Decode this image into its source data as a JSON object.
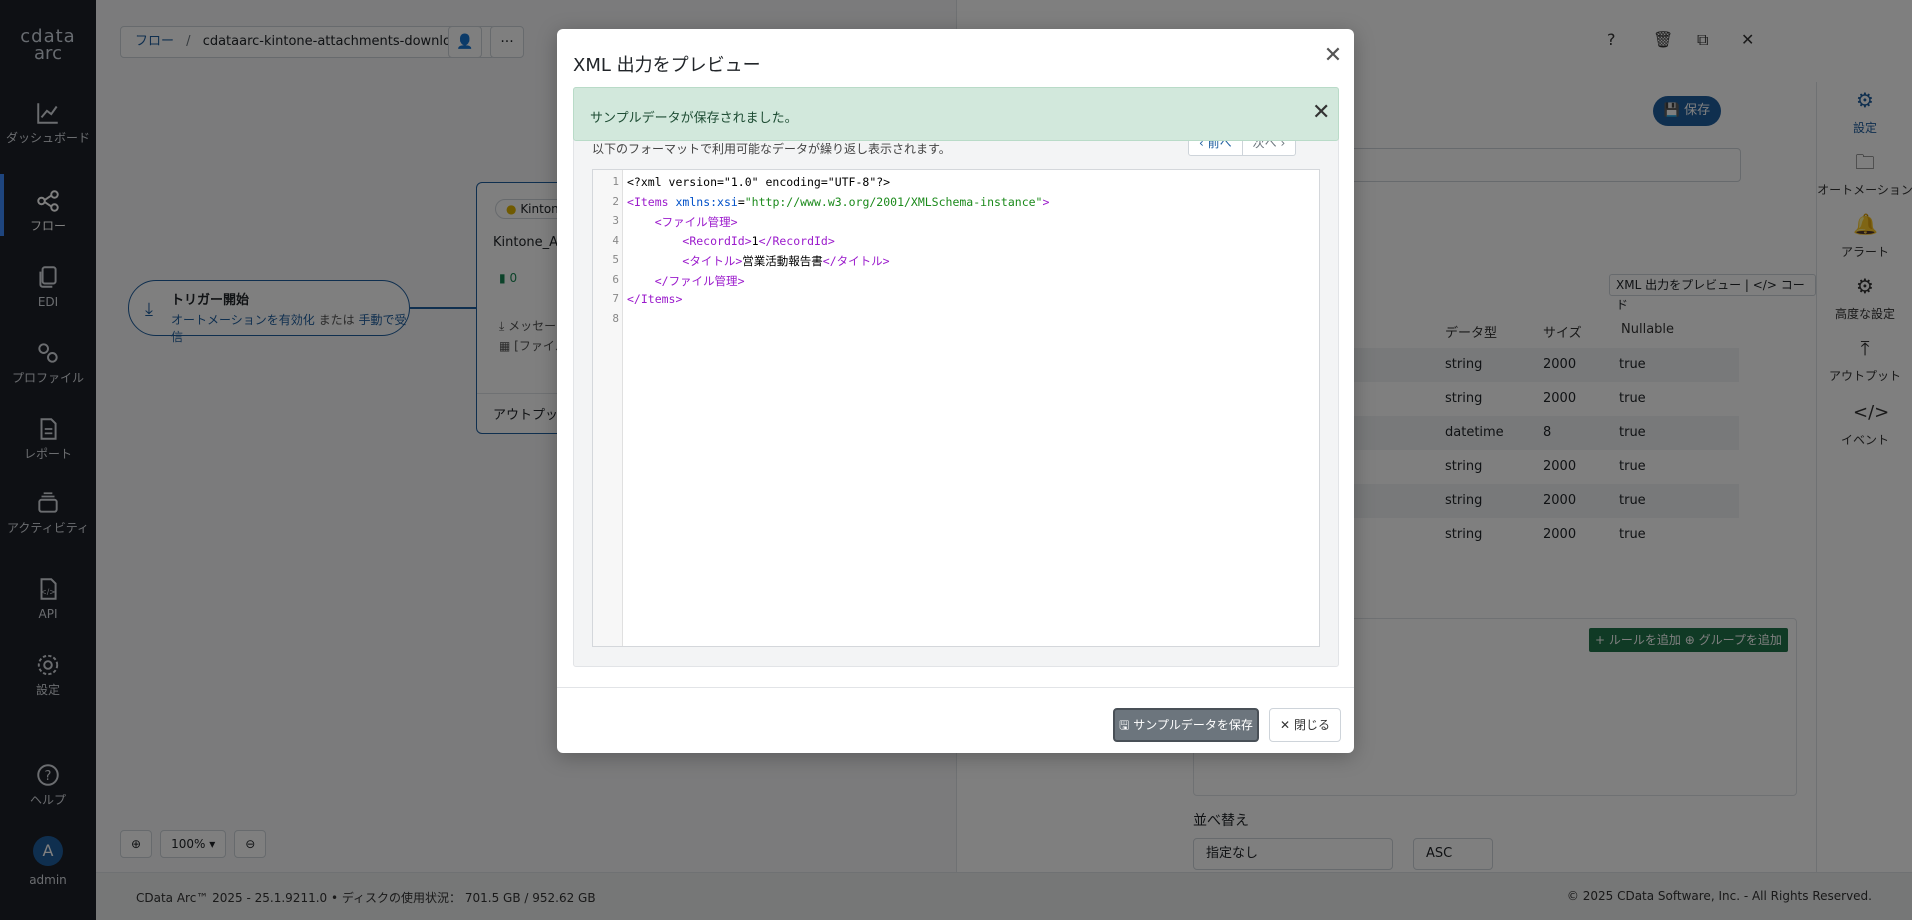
{
  "brand": {
    "name": "cdata",
    "sub": "arc"
  },
  "nav": {
    "items": [
      {
        "label": "ダッシュボード",
        "icon": "chart-line-icon"
      },
      {
        "label": "フロー",
        "icon": "flow-icon"
      },
      {
        "label": "EDI",
        "icon": "document-copy-icon"
      },
      {
        "label": "プロファイル",
        "icon": "gears-icon"
      },
      {
        "label": "レポート",
        "icon": "report-icon"
      },
      {
        "label": "アクティビティ",
        "icon": "layers-icon"
      },
      {
        "label": "API",
        "icon": "api-file-icon"
      },
      {
        "label": "設定",
        "icon": "gear-icon"
      }
    ],
    "help_label": "ヘルプ",
    "user_initial": "A",
    "user_name": "admin"
  },
  "canvas": {
    "breadcrumb_root": "フロー",
    "breadcrumb_sep": "/",
    "breadcrumb_flow": "cdataarc-kintone-attachments-downlo...",
    "trigger_title": "トリガー開始",
    "trigger_link1": "オートメーションを有効化",
    "trigger_or": "または",
    "trigger_link2": "手動で受信",
    "node_pill": "Kinton",
    "node_name": "Kintone_Ap",
    "node_count": "0",
    "node_msg": "メッセー",
    "node_tbl": "[ファイル",
    "node_output": "アウトプット",
    "zoom_level": "100%"
  },
  "right_panel": {
    "save_label": "保存",
    "xml_preview_label": "XML 出力をプレビュー",
    "code_label": "コード",
    "columns": [
      "データ型",
      "サイズ",
      "Nullable"
    ],
    "rows": [
      [
        "string",
        "2000",
        "true"
      ],
      [
        "string",
        "2000",
        "true"
      ],
      [
        "datetime",
        "8",
        "true"
      ],
      [
        "string",
        "2000",
        "true"
      ],
      [
        "string",
        "2000",
        "true"
      ],
      [
        "string",
        "2000",
        "true"
      ]
    ],
    "add_rule_label": "ルールを追加",
    "add_group_label": "グループを追加",
    "sort_label": "並べ替え",
    "sort_value": "指定なし",
    "order_value": "ASC"
  },
  "right_tabs": [
    {
      "label": "設定",
      "icon": "gear-icon"
    },
    {
      "label": "オートメーション",
      "icon": "folder-gear-icon"
    },
    {
      "label": "アラート",
      "icon": "bell-icon"
    },
    {
      "label": "高度な設定",
      "icon": "gears-icon"
    },
    {
      "label": "アウトプット",
      "icon": "upload-icon"
    },
    {
      "label": "イベント",
      "icon": "code-icon"
    }
  ],
  "footer": {
    "version": "CData Arc™ 2025 - 25.1.9211.0",
    "bullet": "•",
    "disk_usage": "ディスクの使用状況： 701.5 GB / 952.62 GB",
    "copyright": "© 2025 CData Software, Inc. - All Rights Reserved."
  },
  "modal": {
    "title": "XML 出力をプレビュー",
    "alert_message": "サンプルデータが保存されました。",
    "description": "以下のフォーマットで利用可能なデータが繰り返し表示されます。",
    "prev_label": "前へ",
    "next_label": "次へ",
    "code_lines": [
      "1",
      "2",
      "3",
      "4",
      "5",
      "6",
      "7",
      "8"
    ],
    "xml": {
      "decl": "<?xml version=\"1.0\" encoding=\"UTF-8\"?>",
      "items_open": "Items",
      "xmlns_attr": "xmlns:xsi",
      "xmlns_val": "\"http://www.w3.org/2001/XMLSchema-instance\"",
      "file_tag": "ファイル管理",
      "record_tag": "RecordId",
      "record_val": "1",
      "title_tag": "タイトル",
      "title_val": "営業活動報告書",
      "items_close": "Items"
    },
    "save_sample_label": "サンプルデータを保存",
    "close_label": "閉じる"
  }
}
